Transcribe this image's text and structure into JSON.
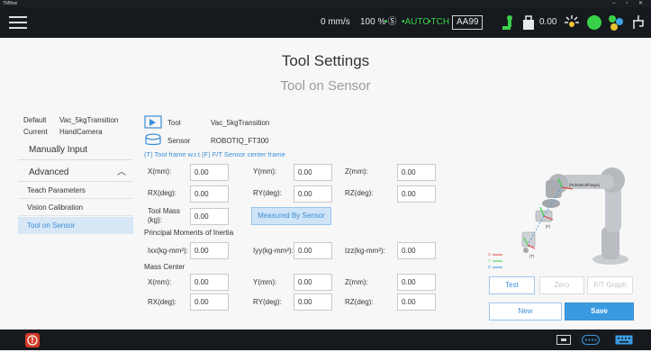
{
  "window": {
    "title": "TMflow",
    "controls": "– ▫ ✕"
  },
  "topbar": {
    "speed": "0 mm/s",
    "percent": "100 %",
    "s_icon": "circled-s",
    "auto": "•AUTO",
    "tch": "•TCH",
    "project": "AA99",
    "payload": "0.00",
    "colors": {
      "bg": "#16191d",
      "green": "#3ad14a"
    }
  },
  "page": {
    "title": "Tool Settings",
    "subtitle": "Tool on Sensor"
  },
  "left": {
    "default_label": "Default",
    "default_value": "Vac_5kgTransition",
    "current_label": "Current",
    "current_value": "HandCamera",
    "manual": "Manually Input",
    "advanced": "Advanced",
    "items": [
      "Teach Parameters",
      "Vision Calibration",
      "Tool on Sensor"
    ]
  },
  "form": {
    "tool_label": "Tool",
    "tool_value": "Vac_5kgTransition",
    "sensor_label": "Sensor",
    "sensor_value": "ROBOTIQ_FT300",
    "frame_note": "(T) Tool frame w.r.t (F) F/T Sensor center frame",
    "pose": [
      {
        "label": "X(mm):",
        "value": "0.00"
      },
      {
        "label": "Y(mm):",
        "value": "0.00"
      },
      {
        "label": "Z(mm):",
        "value": "0.00"
      },
      {
        "label": "RX(deg):",
        "value": "0.00"
      },
      {
        "label": "RY(deg):",
        "value": "0.00"
      },
      {
        "label": "RZ(deg):",
        "value": "0.00"
      }
    ],
    "mass_label": "Tool Mass (kg):",
    "mass_value": "0.00",
    "measure_btn": "Measured By Sensor",
    "inertia_title": "Principal Moments of Inertia",
    "inertia": [
      {
        "label": "Ixx(kg-mm²):",
        "value": "0.00"
      },
      {
        "label": "Iyy(kg-mm²):",
        "value": "0.00"
      },
      {
        "label": "Izz(kg-mm²):",
        "value": "0.00"
      }
    ],
    "mass_center_title": "Mass Center",
    "mass_center": [
      {
        "label": "X(mm):",
        "value": "0.00"
      },
      {
        "label": "Y(mm):",
        "value": "0.00"
      },
      {
        "label": "Z(mm):",
        "value": "0.00"
      },
      {
        "label": "RX(deg):",
        "value": "0.00"
      },
      {
        "label": "RY(deg):",
        "value": "0.00"
      },
      {
        "label": "RZ(deg):",
        "value": "0.00"
      }
    ]
  },
  "robot": {
    "flange_label": "(RobotEndFlange)",
    "f_label": "(F)",
    "t_label": "(T)",
    "axes": [
      "X",
      "Y",
      "Z"
    ]
  },
  "buttons": {
    "test": "Test",
    "zero": "Zero",
    "ft_graph": "F/T Graph",
    "new": "New",
    "save": "Save"
  }
}
